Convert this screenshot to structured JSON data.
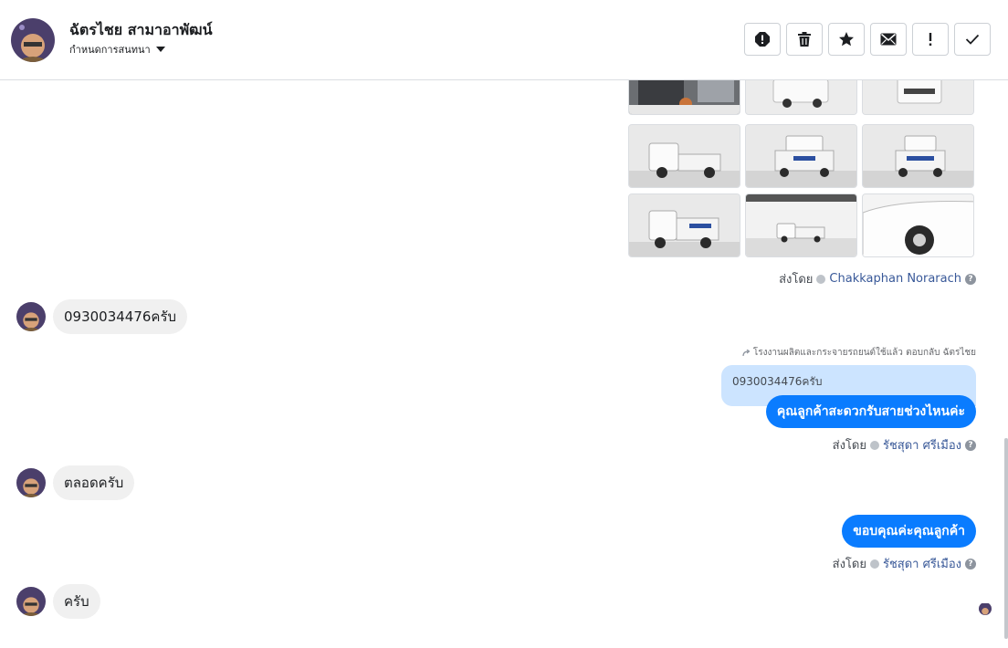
{
  "header": {
    "contact_name": "ฉัตรไชย สามาอาพัฒน์",
    "subtitle": "กำหนดการสนทนา"
  },
  "toolbar": {
    "icons": [
      "spam-icon",
      "trash-icon",
      "star-icon",
      "mail-icon",
      "exclamation-icon",
      "check-icon"
    ]
  },
  "messages": [
    {
      "type": "image_grid",
      "direction": "outgoing",
      "image_count": 9,
      "sent_by_label": "ส่งโดย",
      "sent_by_name": "Chakkaphan Norarach"
    },
    {
      "type": "text",
      "direction": "incoming",
      "text": "0930034476ครับ"
    },
    {
      "type": "reply",
      "direction": "outgoing",
      "reply_meta": "โรงงานผลิตและกระจายรถยนต์ใช้แล้ว ตอบกลับ ฉัตรไชย",
      "quoted_text": "0930034476ครับ",
      "text": "คุณลูกค้าสะดวกรับสายช่วงไหนค่ะ",
      "sent_by_label": "ส่งโดย",
      "sent_by_name": "รัชสุดา ศรีเมือง"
    },
    {
      "type": "text",
      "direction": "incoming",
      "text": "ตลอดครับ"
    },
    {
      "type": "text",
      "direction": "outgoing",
      "text": "ขอบคุณค่ะคุณลูกค้า",
      "sent_by_label": "ส่งโดย",
      "sent_by_name": "รัชสุดา ศรีเมือง"
    },
    {
      "type": "text",
      "direction": "incoming",
      "text": "ครับ"
    }
  ],
  "colors": {
    "outgoing_bubble": "#0a7cff",
    "incoming_bubble": "#f0f0f0",
    "quoted_bubble": "#cce4ff",
    "agent_link": "#385898"
  }
}
